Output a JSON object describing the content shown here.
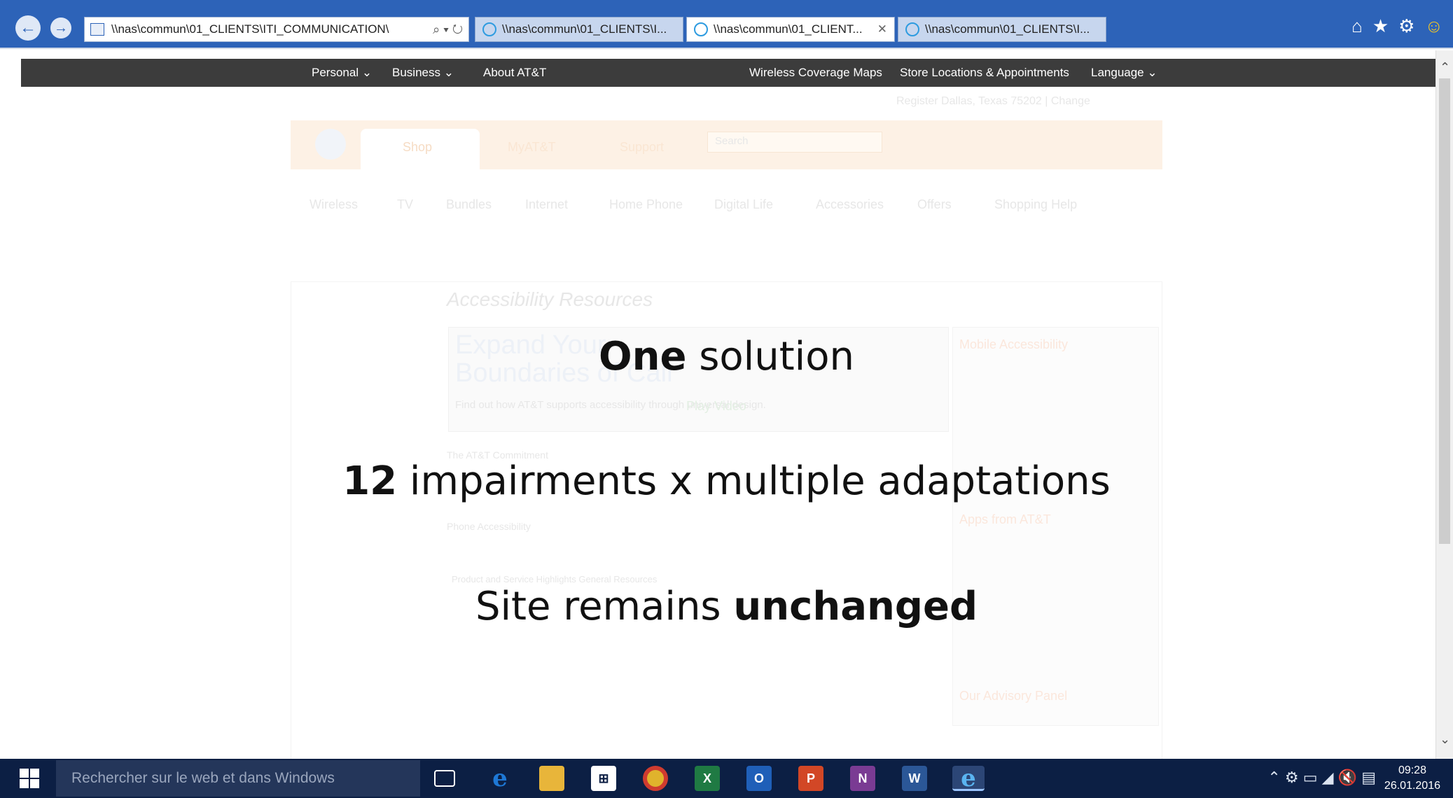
{
  "browser": {
    "address_url": "\\\\nas\\commun\\01_CLIENTS\\ITI_COMMUNICATION\\",
    "address_controls": "⌕ ▾ ↻",
    "tabs": [
      {
        "label": "\\\\nas\\commun\\01_CLIENTS\\I...",
        "active": false
      },
      {
        "label": "\\\\nas\\commun\\01_CLIENT...",
        "active": true
      },
      {
        "label": "\\\\nas\\commun\\01_CLIENTS\\I...",
        "active": false
      }
    ],
    "close_glyph": "✕",
    "back_glyph": "←",
    "forward_glyph": "→",
    "home_glyph": "⌂",
    "favorites_glyph": "★",
    "settings_glyph": "⚙",
    "feedback_glyph": "☺"
  },
  "att_nav": {
    "personal": "Personal ⌄",
    "business": "Business ⌄",
    "about": "About AT&T",
    "coverage": "Wireless Coverage Maps",
    "stores": "Store Locations & Appointments",
    "language": "Language ⌄"
  },
  "att_faded": {
    "register_line": "Register   Dallas, Texas 75202 | Change",
    "shop_tab": "Shop",
    "myatt_tab": "MyAT&T",
    "support_tab": "Support",
    "search_placeholder": "Search",
    "menu": [
      "Wireless",
      "TV",
      "Bundles",
      "Internet",
      "Home Phone",
      "Digital Life",
      "Accessories",
      "Offers",
      "Shopping Help"
    ],
    "section_title": "Accessibility Resources",
    "banner_line1": "Expand Your",
    "banner_line2": "Boundaries of Call",
    "banner_sub": "Find out how AT&T supports accessibility through universal design.",
    "banner_button": "Play Video",
    "commitment": "The AT&T Commitment",
    "phone_access": "Phone Accessibility",
    "highlights": "Product and Service Highlights   General Resources",
    "side_title_1": "Mobile Accessibility",
    "side_title_2": "Apps from AT&T",
    "side_title_3": "Our Advisory Panel"
  },
  "overlay": {
    "line1_bold": "One",
    "line1_rest": " solution",
    "line2_bold": "12",
    "line2_rest": " impairments x multiple adaptations",
    "line3_start": "Site remains ",
    "line3_bold": "unchanged"
  },
  "taskbar": {
    "search_placeholder": "Rechercher sur le web et dans Windows",
    "apps": [
      {
        "name": "task-view",
        "glyph": "▭",
        "color": "#0c1f44"
      },
      {
        "name": "edge",
        "glyph": "e",
        "color": "#1e78d6"
      },
      {
        "name": "file-explorer",
        "glyph": "▬",
        "color": "#e8b53a"
      },
      {
        "name": "store",
        "glyph": "⊞",
        "color": "#ffffff"
      },
      {
        "name": "chrome",
        "glyph": "◉",
        "color": "#e0b32c"
      },
      {
        "name": "excel",
        "glyph": "X",
        "color": "#1f7a43"
      },
      {
        "name": "outlook",
        "glyph": "O",
        "color": "#1f5fb8"
      },
      {
        "name": "powerpoint",
        "glyph": "P",
        "color": "#d24726"
      },
      {
        "name": "onenote",
        "glyph": "N",
        "color": "#7a3b93"
      },
      {
        "name": "word",
        "glyph": "W",
        "color": "#2b5797"
      },
      {
        "name": "internet-explorer",
        "glyph": "e",
        "color": "#2d9be0"
      }
    ],
    "tray_glyphs": "⌃ ⚙ ▭ ◢ 🔇 ▤",
    "time": "09:28",
    "date": "26.01.2016"
  }
}
